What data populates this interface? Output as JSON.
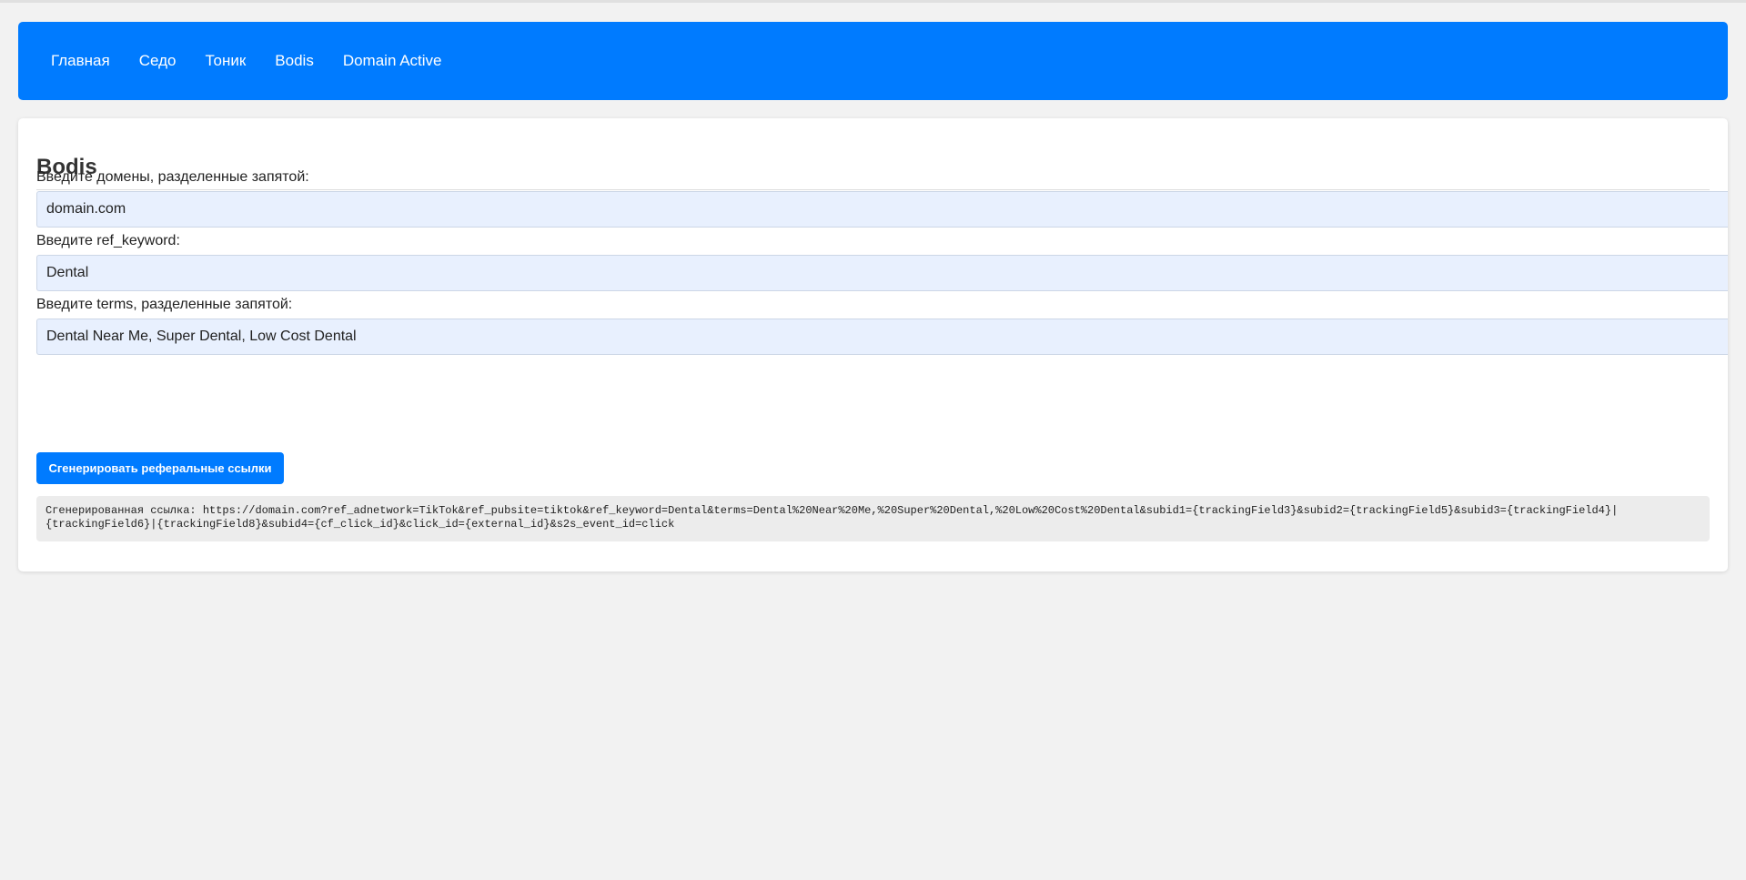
{
  "nav": {
    "items": [
      {
        "label": "Главная"
      },
      {
        "label": "Седо"
      },
      {
        "label": "Тоник"
      },
      {
        "label": "Bodis"
      },
      {
        "label": "Domain Active"
      }
    ]
  },
  "main": {
    "title": "Bodis",
    "domains_label": "Введите домены, разделенные запятой:",
    "domains_value": "domain.com",
    "keyword_label": "Введите ref_keyword:",
    "keyword_value": "Dental",
    "terms_label": "Введите terms, разделенные запятой:",
    "terms_value": "Dental Near Me, Super Dental, Low Cost Dental",
    "generate_button": "Сгенерировать реферальные ссылки",
    "result_text": "Сгенерированная ссылка: https://domain.com?ref_adnetwork=TikTok&ref_pubsite=tiktok&ref_keyword=Dental&terms=Dental%20Near%20Me,%20Super%20Dental,%20Low%20Cost%20Dental&subid1={trackingField3}&subid2={trackingField5}&subid3={trackingField4}|\n{trackingField6}|{trackingField8}&subid4={cf_click_id}&click_id={external_id}&s2s_event_id=click"
  },
  "colors": {
    "accent": "#007bff",
    "page_background": "#f2f2f2",
    "input_background": "#e8f0fe",
    "result_background": "#ececec"
  }
}
